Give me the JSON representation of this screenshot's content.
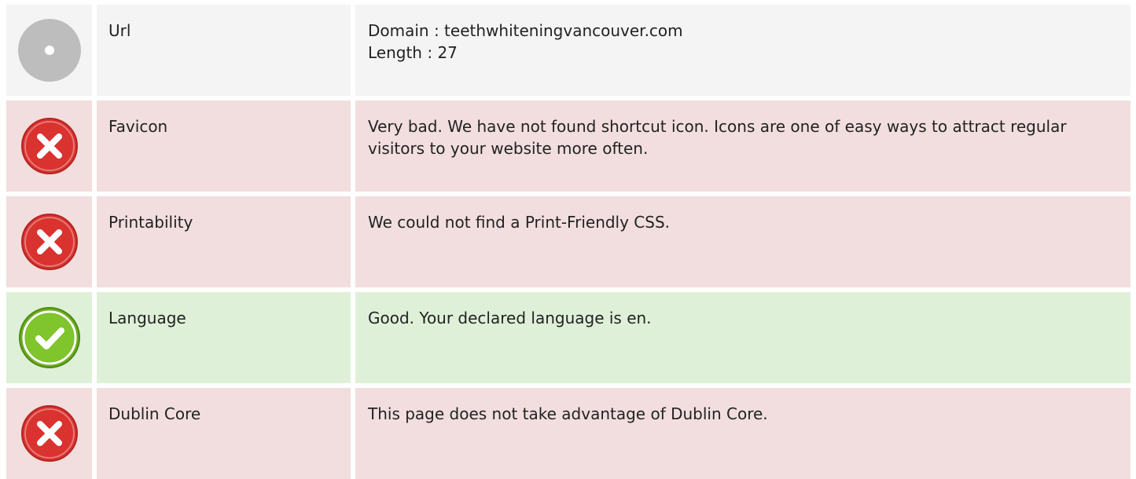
{
  "rows": [
    {
      "status": "neutral",
      "icon": "neutral-dot-icon",
      "name": "Url",
      "lines": [
        "Domain : teethwhiteningvancouver.com",
        "Length : 27"
      ]
    },
    {
      "status": "bad",
      "icon": "error-x-icon",
      "name": "Favicon",
      "lines": [
        "Very bad. We have not found shortcut icon. Icons are one of easy ways to attract regular visitors to your website more often."
      ]
    },
    {
      "status": "bad",
      "icon": "error-x-icon",
      "name": "Printability",
      "lines": [
        "We could not find a Print-Friendly CSS."
      ]
    },
    {
      "status": "good",
      "icon": "success-check-icon",
      "name": "Language",
      "lines": [
        "Good. Your declared language is en."
      ]
    },
    {
      "status": "bad",
      "icon": "error-x-icon",
      "name": "Dublin Core",
      "lines": [
        "This page does not take advantage of Dublin Core."
      ]
    }
  ],
  "colors": {
    "neutral_bg": "#f4f4f4",
    "bad_bg": "#f2dede",
    "good_bg": "#dff0d8",
    "bad_icon": "#d9322f",
    "good_icon": "#6cae20",
    "neutral_icon": "#bdbdbd"
  }
}
